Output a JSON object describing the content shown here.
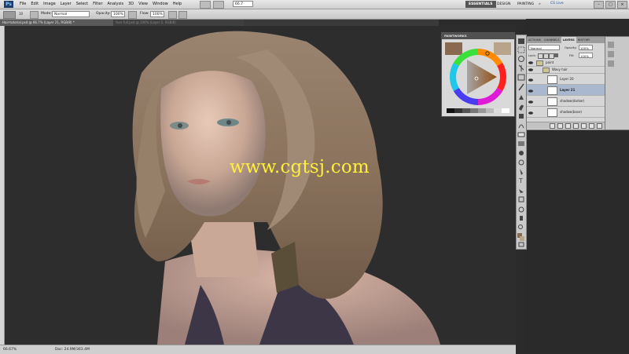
{
  "app": {
    "logo": "Ps"
  },
  "menu": [
    "File",
    "Edit",
    "Image",
    "Layer",
    "Select",
    "Filter",
    "Analysis",
    "3D",
    "View",
    "Window",
    "Help"
  ],
  "zoom_select": "66.7",
  "workspaces": {
    "active": "ESSENTIALS",
    "design": "DESIGN",
    "painting": "PAINTING",
    "more": "»",
    "cs_live": "CS Live"
  },
  "options": {
    "brush_size": "10",
    "mode_label": "Mode:",
    "mode_value": "Normal",
    "opacity_label": "Opacity:",
    "opacity_value": "100%",
    "flow_label": "Flow:",
    "flow_value": "100%"
  },
  "doc_tabs": [
    {
      "label": "Hair-tutorial.psd @ 66.7% (Layer 21, RGB/8) *"
    },
    {
      "label": "face full.psd @ 100% (Layer 2, RGB/8)"
    }
  ],
  "status": {
    "zoom": "66.67%",
    "doc": "Doc: 24.9M/363.4M"
  },
  "layers": {
    "tabs": [
      "ACTIONS",
      "CHANNELS",
      "LAYERS",
      "HISTORY"
    ],
    "active_tab": "LAYERS",
    "blend": "Normal",
    "opacity_label": "Opacity:",
    "opacity_value": "100%",
    "lock_label": "Lock:",
    "fill_label": "Fill:",
    "fill_value": "100%",
    "rows": [
      {
        "name": "paint"
      },
      {
        "name": "Wavy hair"
      },
      {
        "name": "Layer 20"
      },
      {
        "name": "Layer 21"
      },
      {
        "name": "shadow(darker)"
      },
      {
        "name": "shadow(base)"
      }
    ]
  },
  "wheel_panel": {
    "title": "PAINTWORKS"
  },
  "colors": {
    "fg": "#8a6a4e",
    "bg": "#b8a48a",
    "accent": "#555555"
  },
  "watermark": "www.cgtsj.com",
  "icons": [
    "brush-icon",
    "eye-icon",
    "folder-icon",
    "lock-icon",
    "move-icon",
    "lasso-icon",
    "crop-icon",
    "eyedropper-icon",
    "brush-tool-icon",
    "eraser-icon",
    "gradient-icon",
    "pen-icon",
    "type-icon",
    "hand-icon",
    "zoom-icon"
  ]
}
